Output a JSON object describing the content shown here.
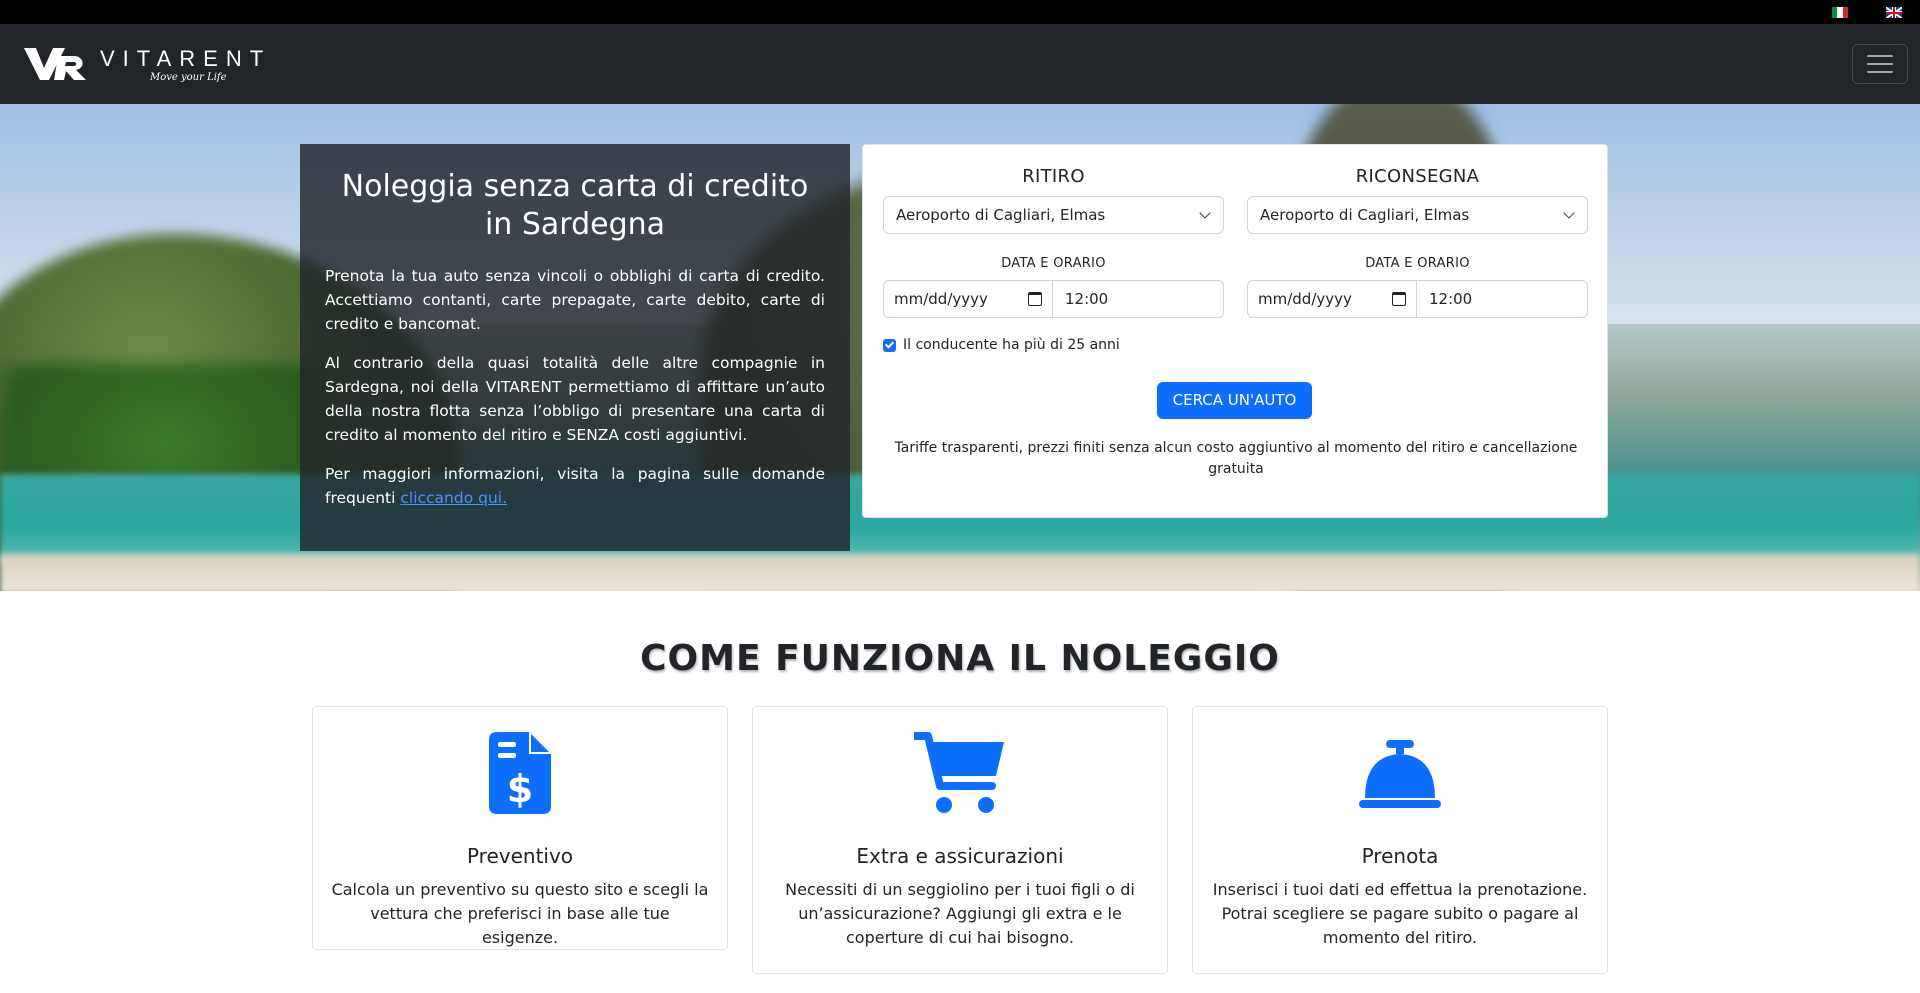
{
  "colors": {
    "navbar": "#212529",
    "accent": "#0d6efd",
    "panel": "#212529"
  },
  "languages": [
    {
      "code": "it",
      "icon": "flag-italy-icon"
    },
    {
      "code": "en",
      "icon": "flag-uk-icon"
    }
  ],
  "brand": {
    "name": "VITARENT",
    "tagline": "Move your Life"
  },
  "hero": {
    "title": "Noleggia senza carta di credito in Sardegna",
    "p1": "Prenota la tua auto senza vincoli o obblighi di carta di credito. Accettiamo contanti, carte prepagate, carte debito, carte di credito e bancomat.",
    "p2": "Al contrario della quasi totalità delle altre compagnie in Sardegna, noi della VITARENT permettiamo di affittare un’auto della nostra flotta senza l’obbligo di presentare una carta di credito al momento del ritiro e SENZA costi aggiuntivi.",
    "p3_text": "Per maggiori informazioni, visita la pagina sulle domande frequenti ",
    "p3_link": "cliccando qui."
  },
  "booking": {
    "pickup": {
      "heading": "RITIRO",
      "location": "Aeroporto di Cagliari, Elmas",
      "datetime_label": "DATA E ORARIO",
      "date_placeholder": "mm/dd/yyyy",
      "time": "12:00"
    },
    "dropoff": {
      "heading": "RICONSEGNA",
      "location": "Aeroporto di Cagliari, Elmas",
      "datetime_label": "DATA E ORARIO",
      "date_placeholder": "mm/dd/yyyy",
      "time": "12:00"
    },
    "age_check_label": "Il conducente ha più di 25 anni",
    "age_checked": true,
    "search_label": "CERCA UN'AUTO",
    "note": "Tariffe trasparenti, prezzi finiti senza alcun costo aggiuntivo al momento del ritiro e cancellazione gratuita"
  },
  "how": {
    "title": "COME FUNZIONA IL NOLEGGIO",
    "cards": [
      {
        "icon": "invoice-dollar-icon",
        "title": "Preventivo",
        "text": "Calcola un preventivo su questo sito e scegli la vettura che preferisci in base alle tue esigenze."
      },
      {
        "icon": "shopping-cart-icon",
        "title": "Extra e assicurazioni",
        "text": "Necessiti di un seggiolino per i tuoi figli o di un’assicurazione? Aggiungi gli extra e le coperture di cui hai bisogno."
      },
      {
        "icon": "service-bell-icon",
        "title": "Prenota",
        "text": "Inserisci i tuoi dati ed effettua la prenotazione. Potrai scegliere se pagare subito o pagare al momento del ritiro."
      }
    ]
  }
}
